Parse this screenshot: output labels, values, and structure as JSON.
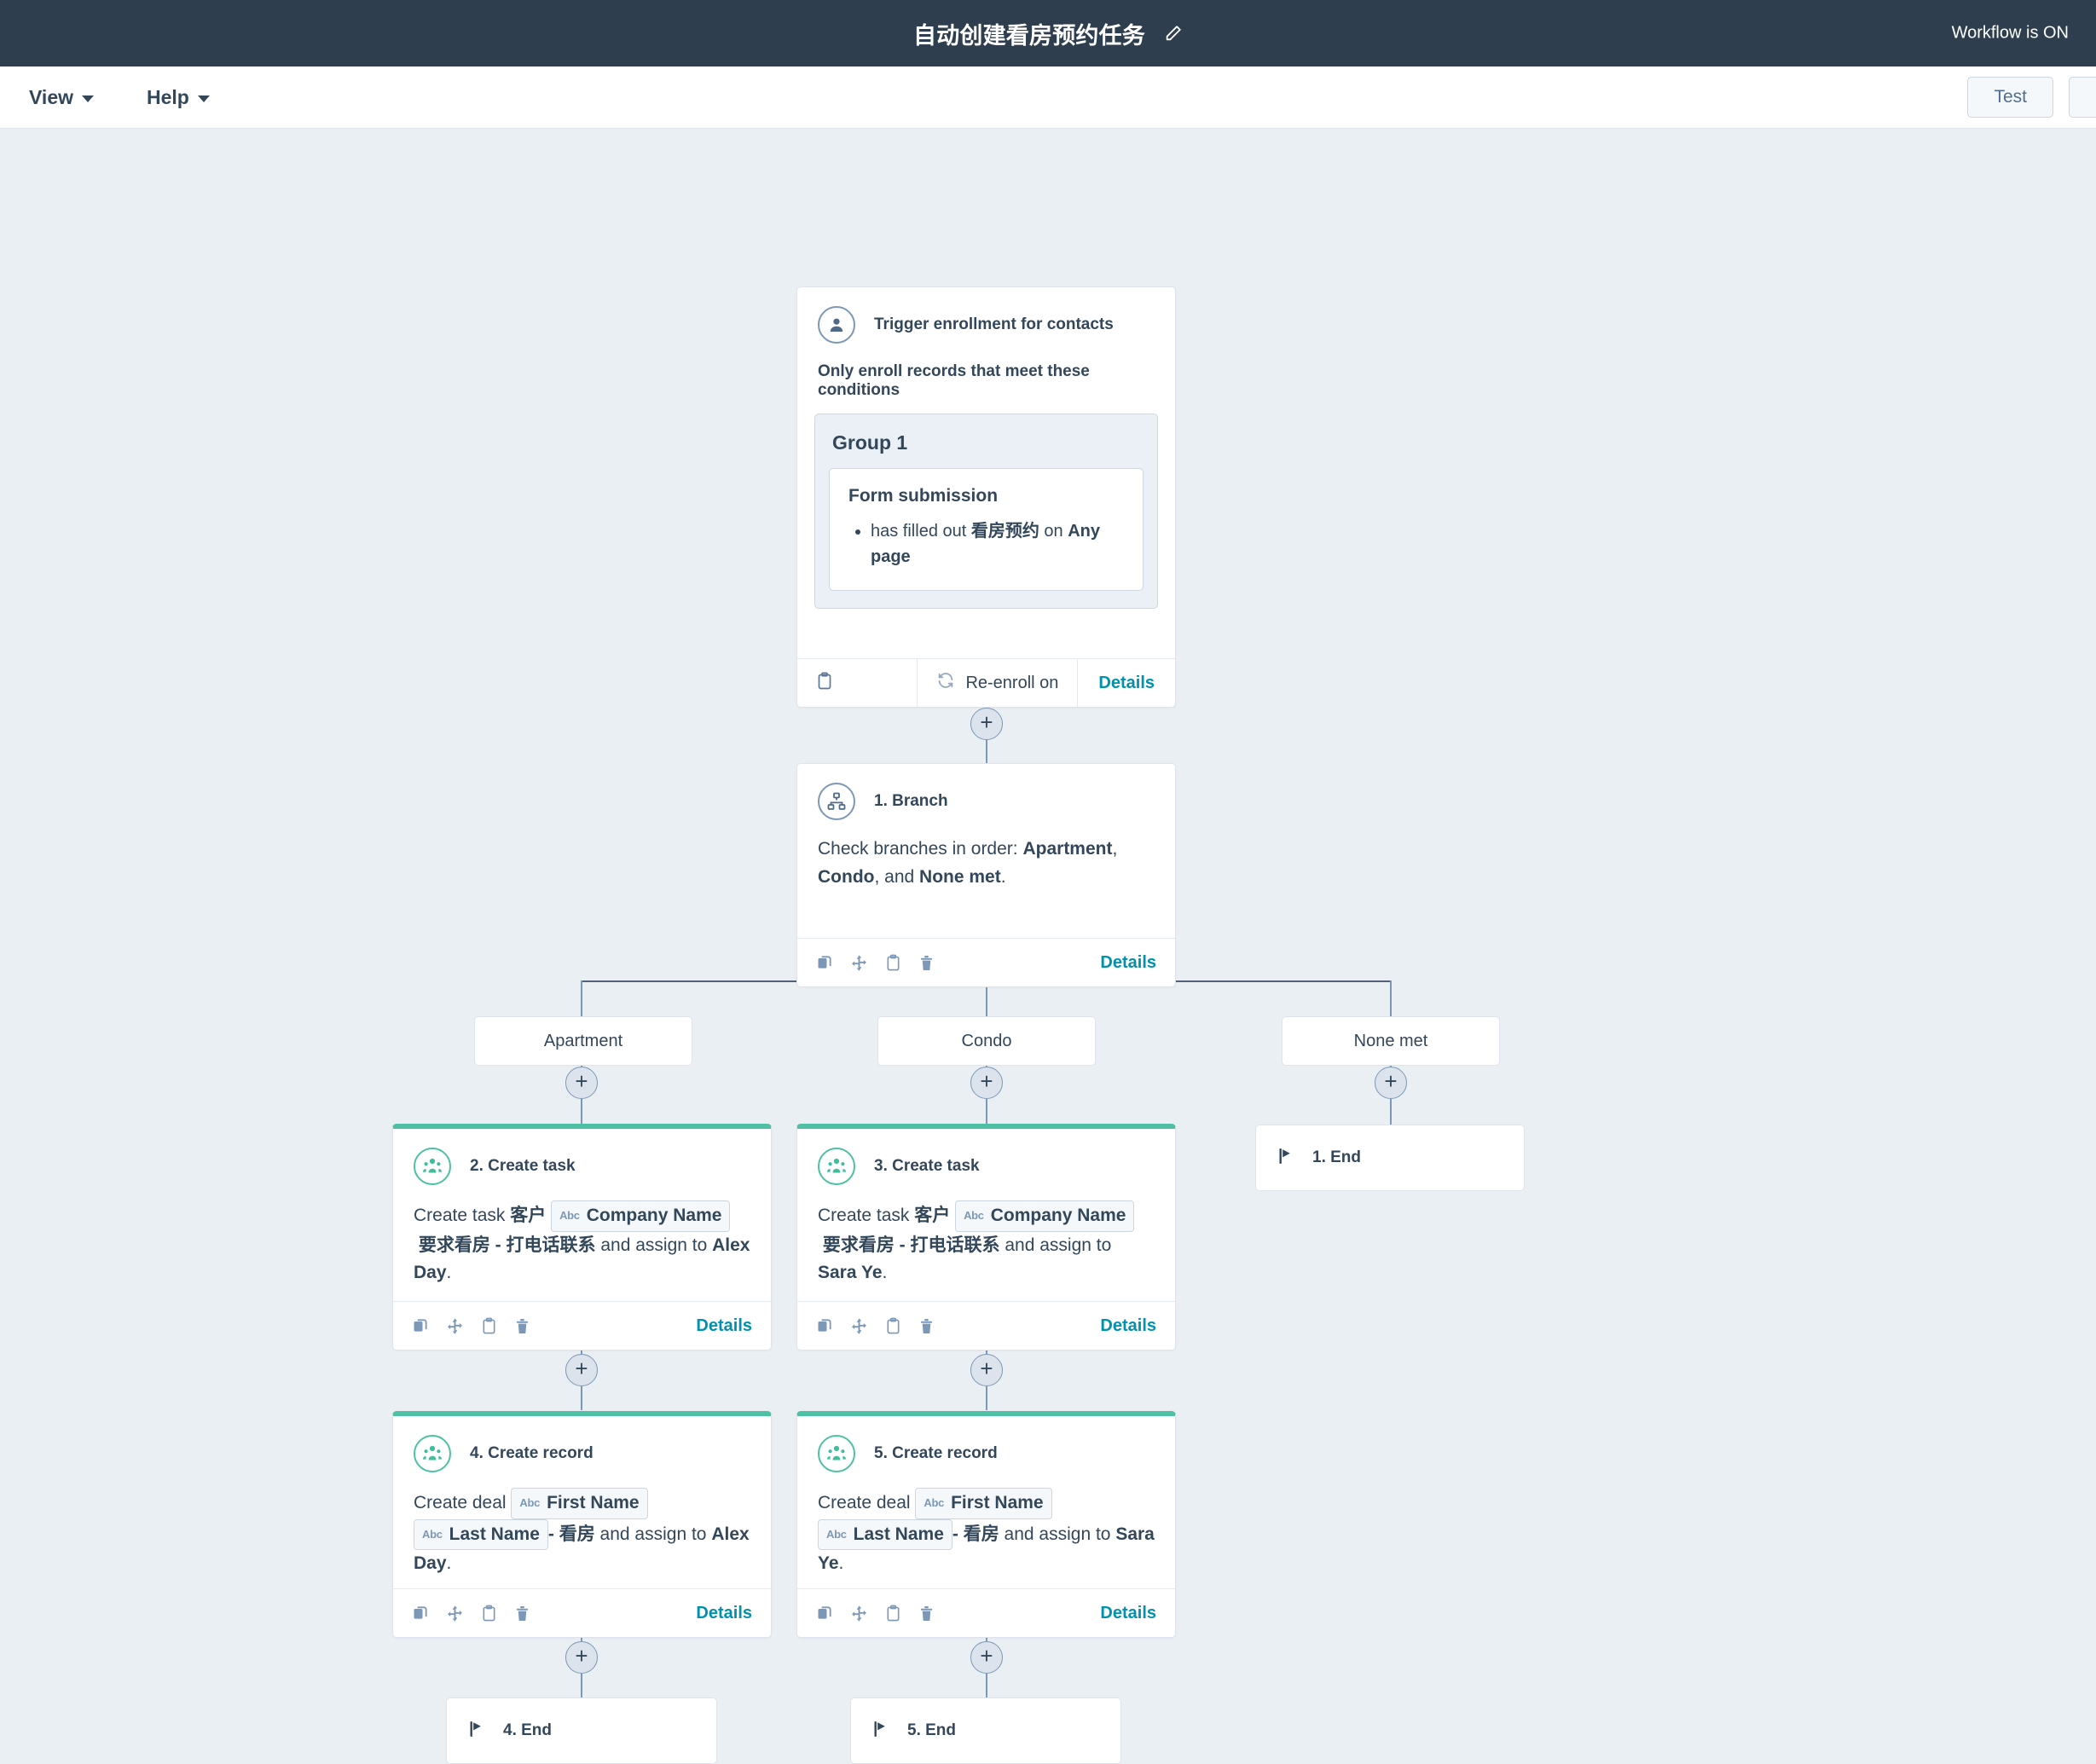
{
  "topbar": {
    "title": "自动创建看房预约任务",
    "edit_icon": "pencil-icon",
    "status": "Workflow is ON"
  },
  "menubar": {
    "items": [
      {
        "label": "View",
        "icon": "chevron-down-icon"
      },
      {
        "label": "Help",
        "icon": "chevron-down-icon"
      }
    ],
    "test_label": "Test"
  },
  "trigger": {
    "icon": "contact-person-icon",
    "title": "Trigger enrollment for contacts",
    "subhead": "Only enroll records that meet these conditions",
    "group_title": "Group 1",
    "condition_title": "Form submission",
    "condition_prefix": "has filled out ",
    "condition_form": "看房预约",
    "condition_middle": " on ",
    "condition_page": "Any page",
    "note_icon": "clipboard-icon",
    "reenroll_icon": "refresh-icon",
    "reenroll_label": "Re-enroll on",
    "details_label": "Details"
  },
  "branch_step": {
    "icon": "branch-icon",
    "title": "1. Branch",
    "text_prefix": "Check branches in order: ",
    "b1": "Apartment",
    "sep1": ", ",
    "b2": "Condo",
    "sep2": ", and ",
    "b3": "None met",
    "period": ".",
    "details_label": "Details",
    "footer_icons": [
      "copy-icon",
      "move-icon",
      "clipboard-icon",
      "trash-icon"
    ]
  },
  "branch_labels": [
    {
      "label": "Apartment"
    },
    {
      "label": "Condo"
    },
    {
      "label": "None met"
    }
  ],
  "steps": {
    "create_task_apartment": {
      "icon": "create-task-icon",
      "title": "2. Create task",
      "prefix": "Create task ",
      "cn1": "客户",
      "token": {
        "type": "Abc",
        "label": "Company Name"
      },
      "cn2": "要求看房 - 打电话联系",
      "mid": " and assign to ",
      "owner": "Alex Day",
      "period": ".",
      "details_label": "Details",
      "footer_icons": [
        "copy-icon",
        "move-icon",
        "clipboard-icon",
        "trash-icon"
      ]
    },
    "create_task_condo": {
      "icon": "create-task-icon",
      "title": "3. Create task",
      "prefix": "Create task ",
      "cn1": "客户",
      "token": {
        "type": "Abc",
        "label": "Company Name"
      },
      "cn2": "要求看房 - 打电话联系",
      "mid": " and assign to ",
      "owner": "Sara Ye",
      "period": ".",
      "details_label": "Details",
      "footer_icons": [
        "copy-icon",
        "move-icon",
        "clipboard-icon",
        "trash-icon"
      ]
    },
    "create_record_apartment": {
      "icon": "create-record-icon",
      "title": "4. Create record",
      "prefix": "Create deal ",
      "token1": {
        "type": "Abc",
        "label": "First Name"
      },
      "token2": {
        "type": "Abc",
        "label": "Last Name"
      },
      "cn": "- 看房",
      "mid": " and assign to ",
      "owner": "Alex Day",
      "period": ".",
      "details_label": "Details",
      "footer_icons": [
        "copy-icon",
        "move-icon",
        "clipboard-icon",
        "trash-icon"
      ]
    },
    "create_record_condo": {
      "icon": "create-record-icon",
      "title": "5. Create record",
      "prefix": "Create deal ",
      "token1": {
        "type": "Abc",
        "label": "First Name"
      },
      "token2": {
        "type": "Abc",
        "label": "Last Name"
      },
      "cn": "- 看房",
      "mid": " and assign to ",
      "owner": "Sara Ye",
      "period": ".",
      "details_label": "Details",
      "footer_icons": [
        "copy-icon",
        "move-icon",
        "clipboard-icon",
        "trash-icon"
      ]
    }
  },
  "ends": [
    {
      "icon": "flag-icon",
      "label": "1. End"
    },
    {
      "icon": "flag-icon",
      "label": "4. End"
    },
    {
      "icon": "flag-icon",
      "label": "5. End"
    }
  ],
  "colors": {
    "topbar_bg": "#2e3e4e",
    "canvas_bg": "#eaeff4",
    "accent_link": "#0091ae",
    "step_green": "#4ec0a3",
    "connector": "#7c98b6"
  }
}
